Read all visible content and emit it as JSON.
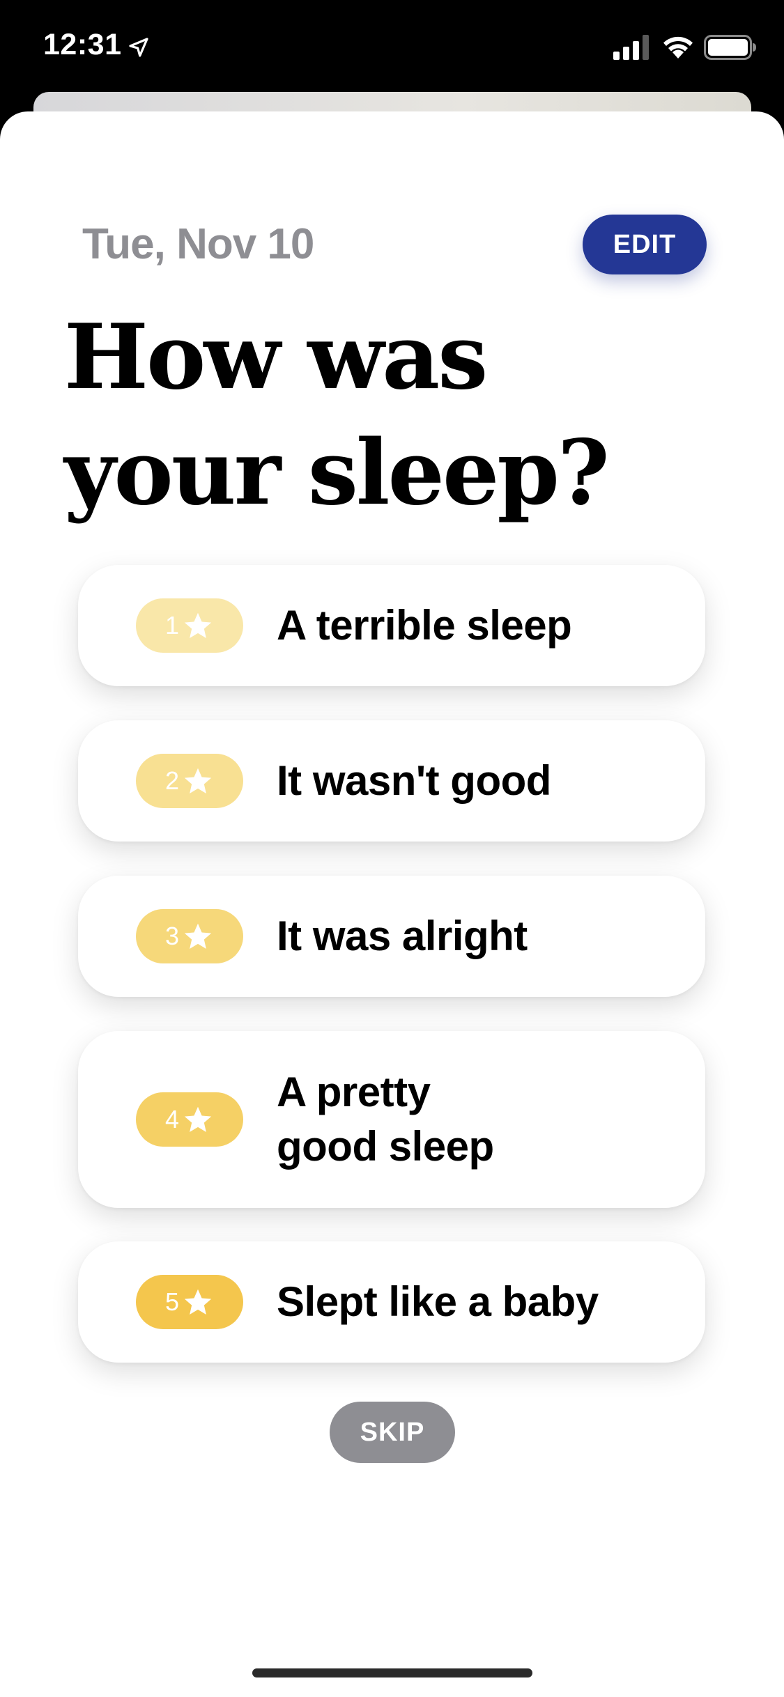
{
  "status_bar": {
    "time": "12:31",
    "icons": [
      "location-arrow-icon",
      "cellular-signal-icon",
      "wifi-icon",
      "battery-icon"
    ]
  },
  "header": {
    "date": "Tue, Nov 10",
    "edit_label": "EDIT",
    "title_line1": "How was",
    "title_line2": "your sleep?"
  },
  "options": [
    {
      "rating": "1",
      "label": "A terrible sleep",
      "badge_color": "#F9E7A9"
    },
    {
      "rating": "2",
      "label": "It wasn't good",
      "badge_color": "#F8E092"
    },
    {
      "rating": "3",
      "label": "It was alright",
      "badge_color": "#F6D87A"
    },
    {
      "rating": "4",
      "label_line1": "A pretty",
      "label_line2": "good sleep",
      "badge_color": "#F5D065"
    },
    {
      "rating": "5",
      "label": "Slept like a baby",
      "badge_color": "#F4C64D"
    }
  ],
  "skip_label": "SKIP",
  "colors": {
    "accent": "#243795",
    "muted": "#8E8E93"
  }
}
